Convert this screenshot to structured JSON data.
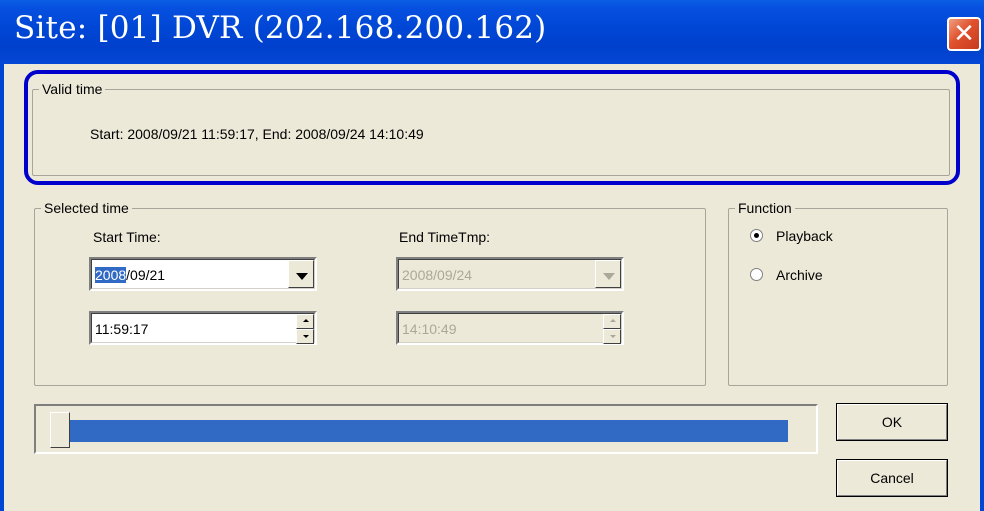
{
  "window": {
    "title": "Site: [01] DVR (202.168.200.162)",
    "close_glyph": "✕"
  },
  "valid_time": {
    "legend": "Valid time",
    "text": "Start: 2008/09/21 11:59:17,  End: 2008/09/24 14:10:49",
    "highlight_color": "#0000cc"
  },
  "selected_time": {
    "legend": "Selected time",
    "start_label": "Start Time:",
    "end_label": "End TimeTmp:",
    "start_date_year": "2008",
    "start_date_rest": "/09/21",
    "start_time": "11:59:17",
    "end_date": "2008/09/24",
    "end_time": "14:10:49"
  },
  "function": {
    "legend": "Function",
    "options": [
      {
        "label": "Playback",
        "selected": true
      },
      {
        "label": "Archive",
        "selected": false
      }
    ]
  },
  "slider": {
    "position": 0,
    "fill_color": "#316ac5"
  },
  "buttons": {
    "ok": "OK",
    "cancel": "Cancel"
  },
  "colors": {
    "titlebar": "#0046d5",
    "dialog_bg": "#ece9d8",
    "selection": "#316ac5"
  }
}
